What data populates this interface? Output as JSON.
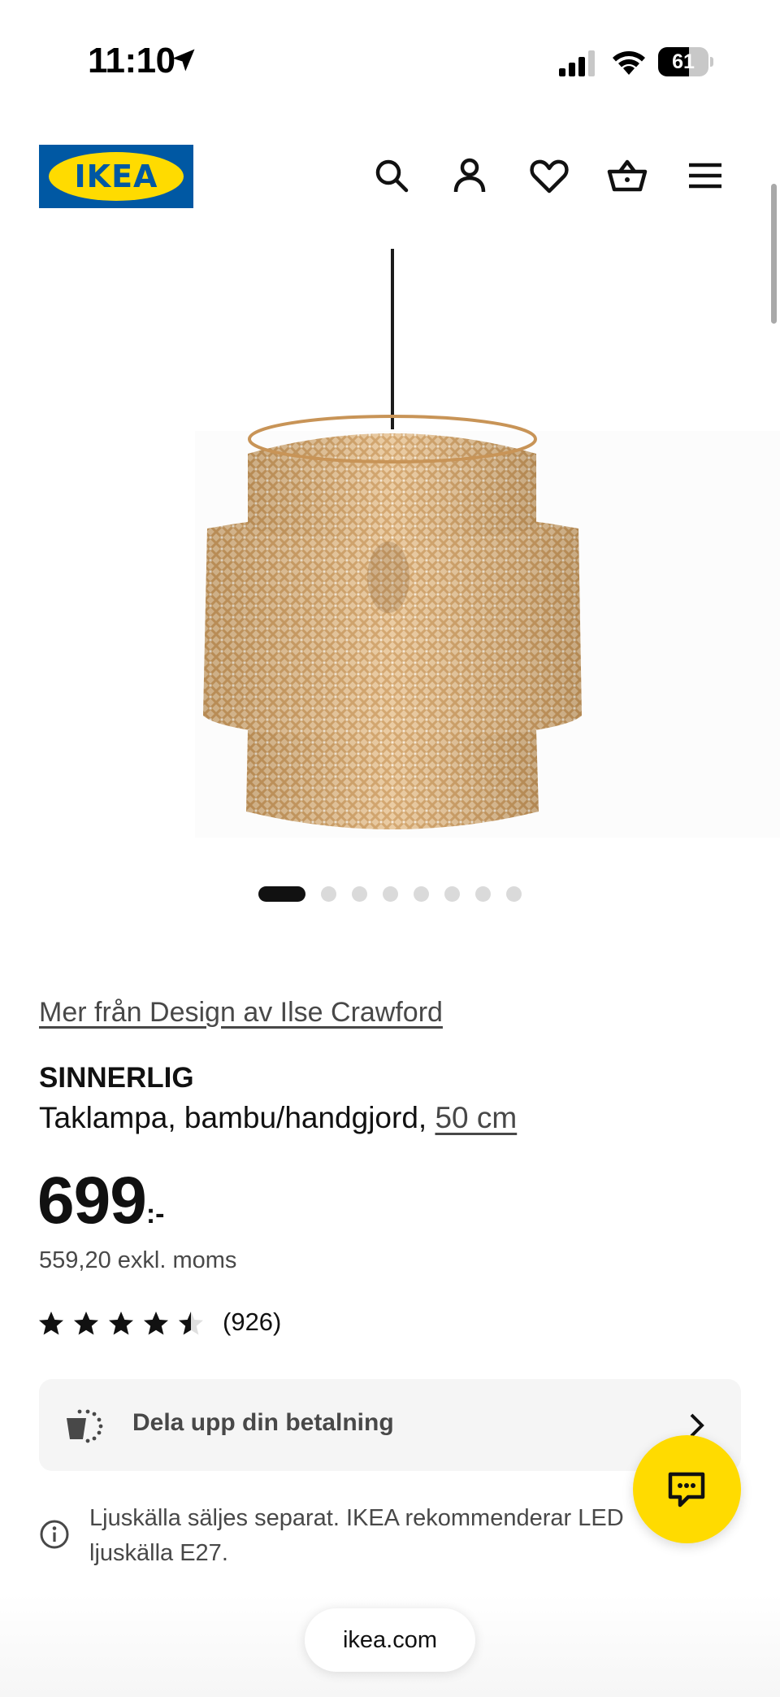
{
  "status_bar": {
    "time": "11:10",
    "battery_level": "61",
    "battery_fraction": 0.61,
    "icons": [
      "location-arrow-icon",
      "signal-icon",
      "wifi-icon",
      "battery-icon"
    ]
  },
  "header": {
    "logo_text": "IKEA",
    "icons": [
      "search-icon",
      "account-icon",
      "heart-icon",
      "cart-icon",
      "menu-icon"
    ]
  },
  "product": {
    "image_alt_icon": "pendant-lamp-image",
    "carousel": {
      "count": 8,
      "active_index": 0
    },
    "designer_link": "Mer från Design av Ilse Crawford",
    "name": "SINNERLIG",
    "description": "Taklampa, bambu/handgjord, ",
    "size_link": "50 cm",
    "price": "699",
    "price_suffix": ":-",
    "price_excl_vat": "559,20 exkl. moms",
    "rating": {
      "value": 4.5,
      "max": 5,
      "count_text": "(926)"
    }
  },
  "payment": {
    "label": "Dela upp din betalning",
    "icon": "split-payment-icon"
  },
  "info": {
    "text": "Ljuskälla säljes separat. IKEA rekommenderar LED ljuskälla E27.",
    "icon": "info-icon"
  },
  "chat": {
    "icon": "chat-icon"
  },
  "browser": {
    "url": "ikea.com"
  },
  "colors": {
    "ikea_blue": "#0058a3",
    "ikea_yellow": "#ffdb00",
    "text_primary": "#111111",
    "text_secondary": "#484848",
    "card_bg": "#f5f5f5"
  }
}
